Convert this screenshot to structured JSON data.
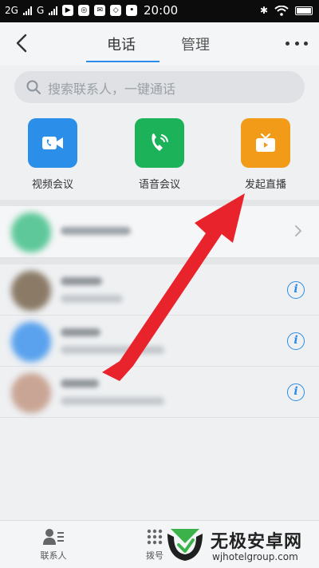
{
  "status_bar": {
    "network_1": "2G",
    "network_2": "G",
    "time": "20:00"
  },
  "header": {
    "tabs": [
      {
        "label": "电话",
        "active": true
      },
      {
        "label": "管理",
        "active": false
      }
    ]
  },
  "search": {
    "placeholder": "搜索联系人，一键通话"
  },
  "actions": [
    {
      "label": "视频会议",
      "icon": "video-call-icon",
      "color": "#2b8fe9"
    },
    {
      "label": "语音会议",
      "icon": "voice-call-icon",
      "color": "#1bb25a"
    },
    {
      "label": "发起直播",
      "icon": "live-tv-icon",
      "color": "#f29b18"
    }
  ],
  "bottom_nav": [
    {
      "label": "联系人",
      "icon": "contacts-icon"
    },
    {
      "label": "拨号",
      "icon": "dialpad-icon"
    }
  ],
  "watermark": {
    "title": "无极安卓网",
    "url": "wjhotelgroup.com"
  },
  "colors": {
    "accent": "#2a8ce8",
    "annotation_arrow": "#e8232b"
  }
}
